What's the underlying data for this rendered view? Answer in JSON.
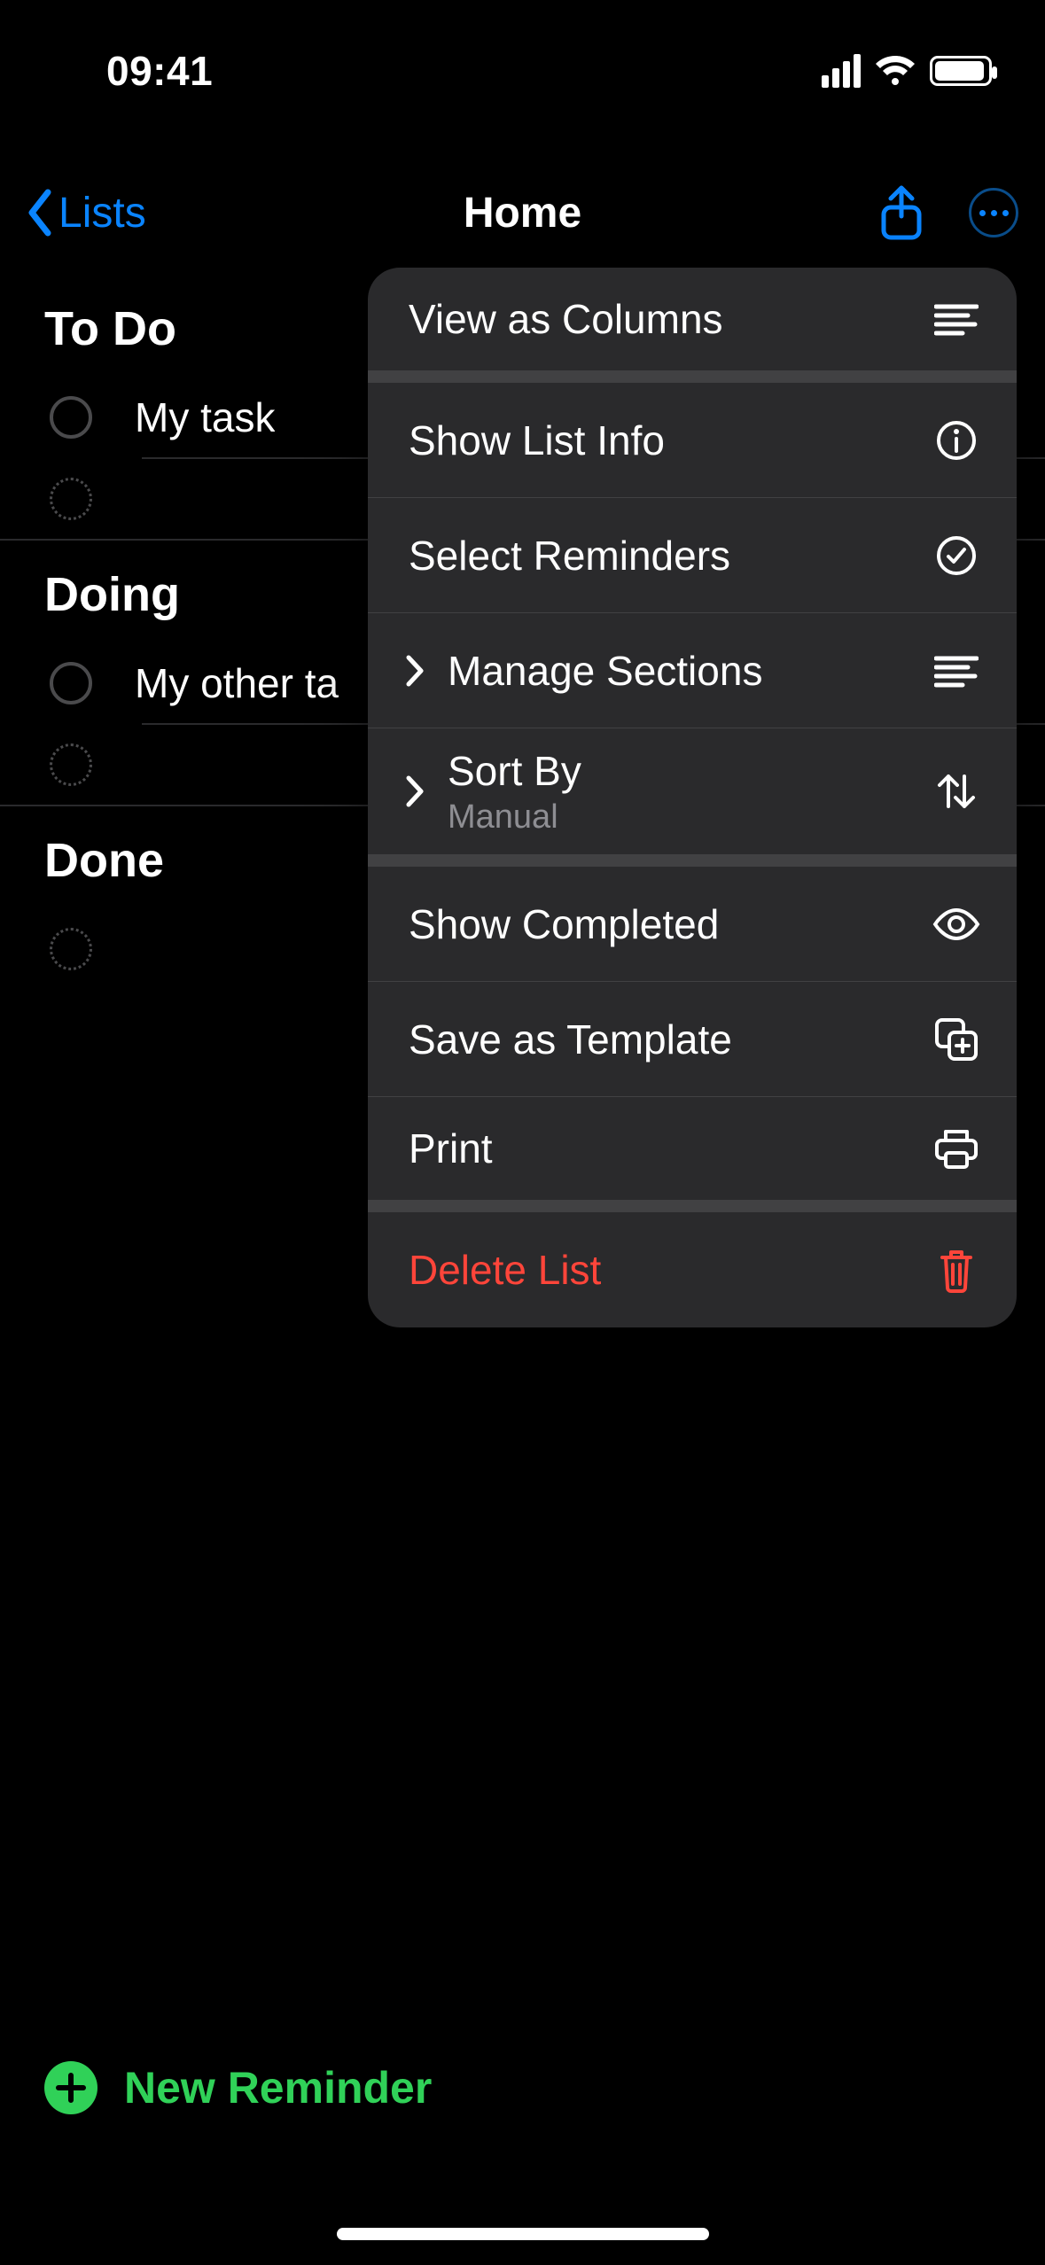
{
  "status": {
    "time": "09:41"
  },
  "nav": {
    "back_label": "Lists",
    "title": "Home"
  },
  "sections": [
    {
      "title": "To Do",
      "tasks": [
        {
          "label": "My task"
        }
      ]
    },
    {
      "title": "Doing",
      "tasks": [
        {
          "label": "My other ta"
        }
      ]
    },
    {
      "title": "Done",
      "tasks": []
    }
  ],
  "footer": {
    "new_reminder_label": "New Reminder"
  },
  "popover": {
    "view_as_columns": "View as Columns",
    "show_list_info": "Show List Info",
    "select_reminders": "Select Reminders",
    "manage_sections": "Manage Sections",
    "sort_by": {
      "label": "Sort By",
      "value": "Manual"
    },
    "show_completed": "Show Completed",
    "save_as_template": "Save as Template",
    "print": "Print",
    "delete_list": "Delete List"
  },
  "colors": {
    "accent_blue": "#0a84ff",
    "green": "#30d158",
    "red": "#ff453a"
  }
}
